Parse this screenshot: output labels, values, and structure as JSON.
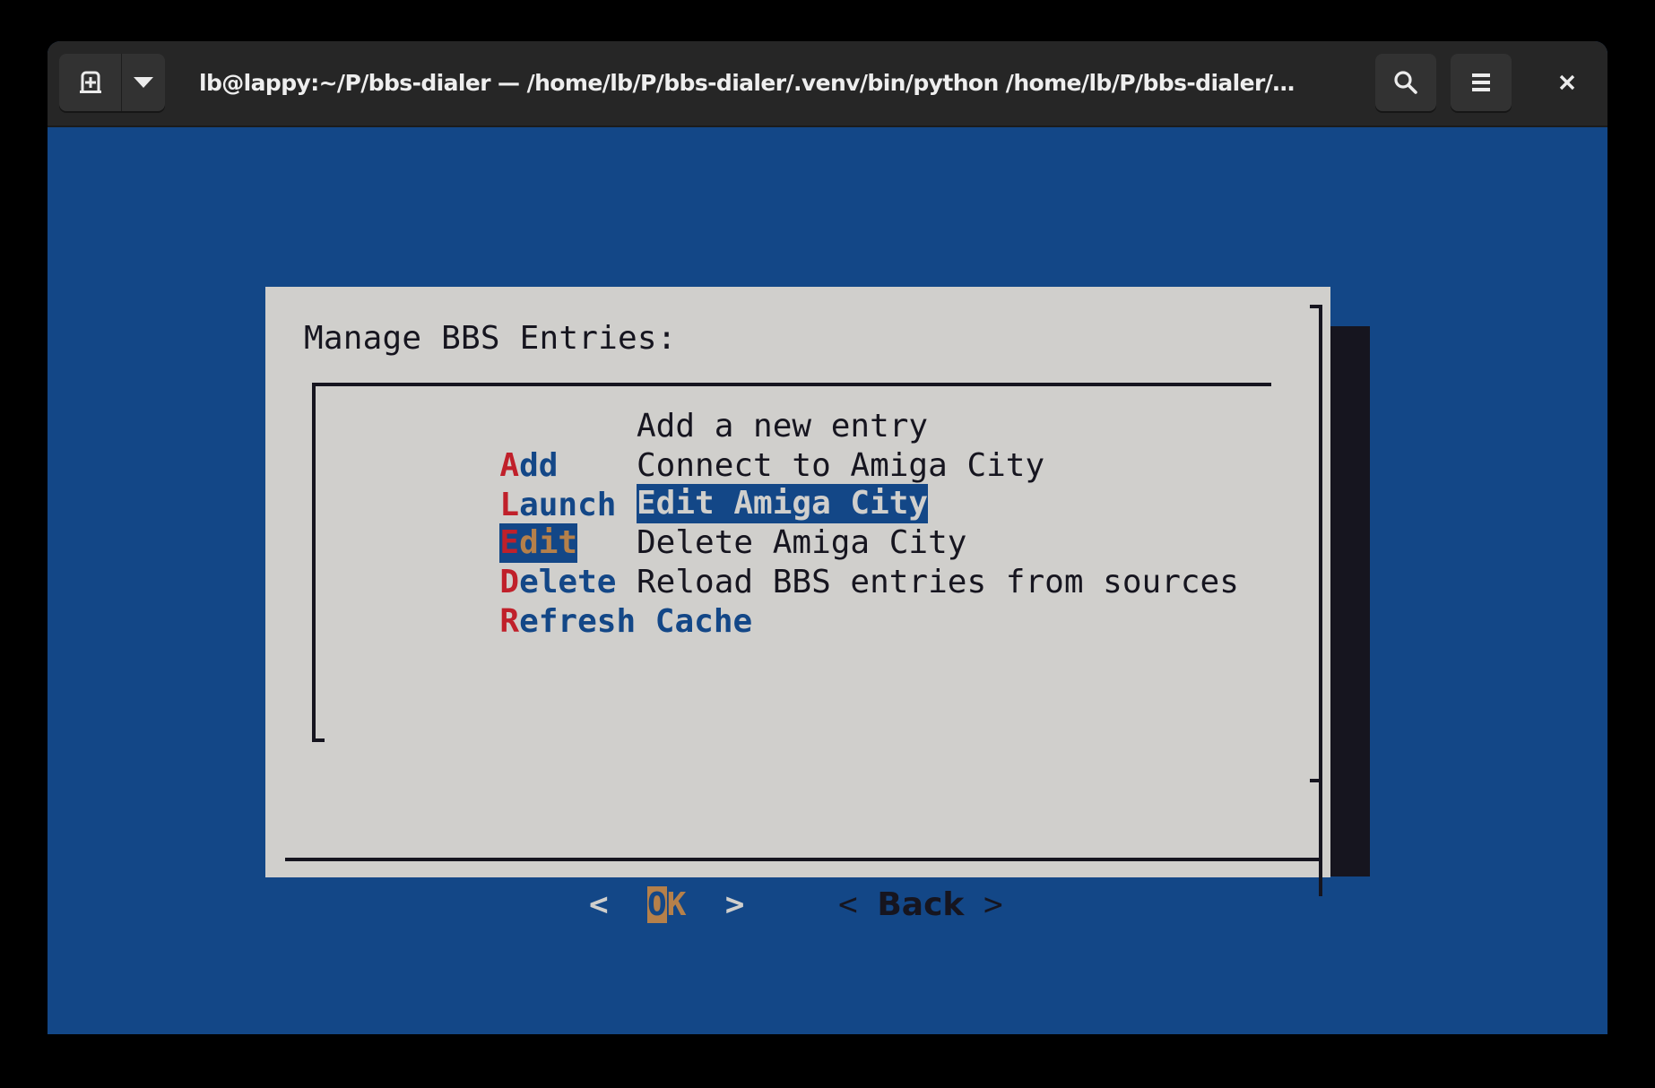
{
  "window": {
    "title": "lb@lappy:~/P/bbs-dialer — /home/lb/P/bbs-dialer/.venv/bin/python /home/lb/P/bbs-dialer/…",
    "buttons": {
      "new_tab_icon": "new-tab-icon",
      "dropdown_icon": "chevron-down-icon",
      "search_icon": "search-icon",
      "menu_icon": "hamburger-menu-icon",
      "close_icon": "close-icon"
    }
  },
  "dialog": {
    "title": "Manage BBS Entries:",
    "items": [
      {
        "hotkey": "A",
        "rest": "dd",
        "description": "Add a new entry",
        "selected": false
      },
      {
        "hotkey": "L",
        "rest": "aunch",
        "description": "Connect to Amiga City",
        "selected": false
      },
      {
        "hotkey": "E",
        "rest": "dit",
        "description": "Edit Amiga City",
        "selected": true
      },
      {
        "hotkey": "D",
        "rest": "elete",
        "description": "Delete Amiga City",
        "selected": false
      },
      {
        "hotkey": "R",
        "rest": "efresh Cache",
        "description": "Reload BBS entries from sources",
        "selected": false
      }
    ],
    "buttons": {
      "ok": {
        "left": "<  ",
        "hotkey": "O",
        "rest": "K",
        "right": "  >"
      },
      "back": {
        "left": "< ",
        "label": "Back",
        "right": " >"
      }
    }
  },
  "colors": {
    "terminal_bg": "#134787",
    "dialog_bg": "#d0cfcc",
    "shadow": "#16151f",
    "hotkey_red": "#c0202a",
    "accent_tan": "#b5804a"
  }
}
